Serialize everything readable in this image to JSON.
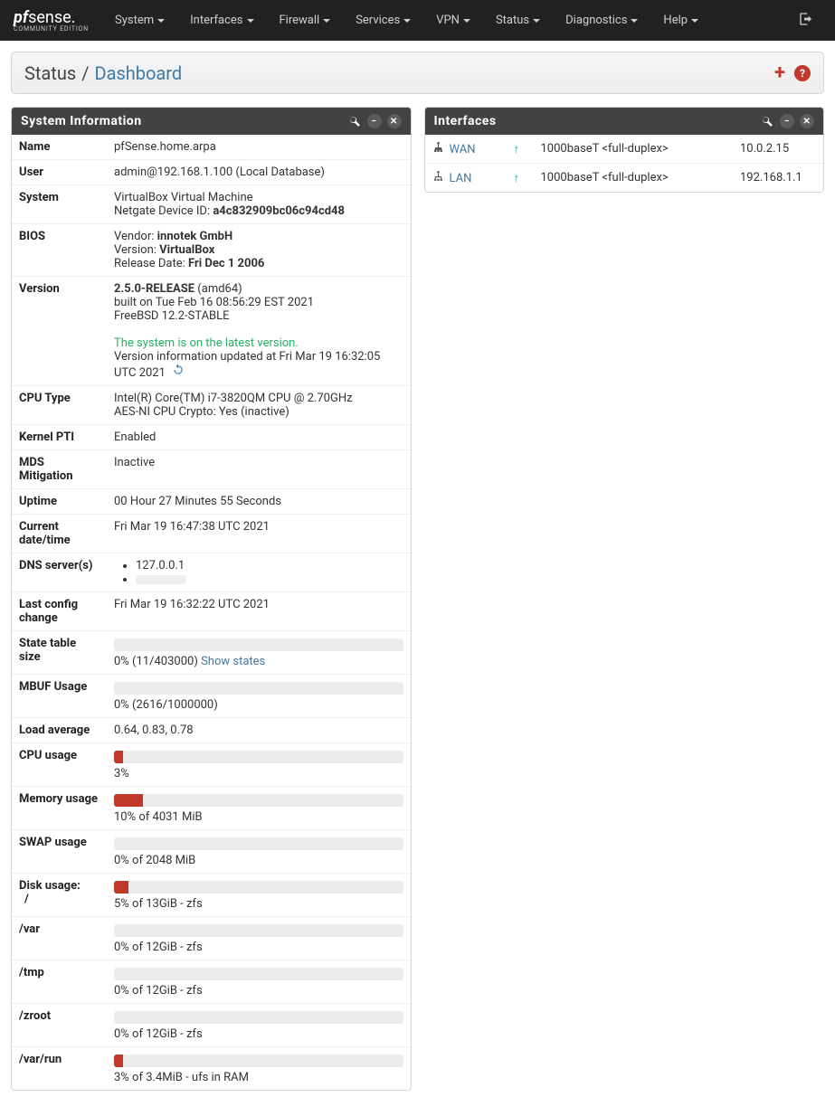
{
  "logo": {
    "pf": "pf",
    "sense": "sense",
    "period": ".",
    "ce": "COMMUNITY EDITION"
  },
  "nav": [
    "System",
    "Interfaces",
    "Firewall",
    "Services",
    "VPN",
    "Status",
    "Diagnostics",
    "Help"
  ],
  "breadcrumb": {
    "root": "Status",
    "page": "Dashboard"
  },
  "panels": {
    "sysinfo": "System Information",
    "ifaces": "Interfaces"
  },
  "sys": {
    "name_k": "Name",
    "name_v": "pfSense.home.arpa",
    "user_k": "User",
    "user_v": "admin@192.168.1.100 (Local Database)",
    "system_k": "System",
    "system_v1": "VirtualBox Virtual Machine",
    "system_v2_lbl": "Netgate Device ID: ",
    "system_v2_val": "a4c832909bc06c94cd48",
    "bios_k": "BIOS",
    "bios_vendor_lbl": "Vendor: ",
    "bios_vendor_val": "innotek GmbH",
    "bios_ver_lbl": "Version: ",
    "bios_ver_val": "VirtualBox",
    "bios_rel_lbl": "Release Date: ",
    "bios_rel_val": "Fri Dec 1 2006",
    "ver_k": "Version",
    "ver_rel": "2.5.0-RELEASE",
    "ver_arch": " (amd64)",
    "ver_built": "built on Tue Feb 16 08:56:29 EST 2021",
    "ver_os": "FreeBSD 12.2-STABLE",
    "ver_latest": "The system is on the latest version.",
    "ver_updated": "Version information updated at Fri Mar 19 16:32:05 UTC 2021",
    "cpu_k": "CPU Type",
    "cpu_v1": "Intel(R) Core(TM) i7-3820QM CPU @ 2.70GHz",
    "cpu_v2": "AES-NI CPU Crypto: Yes (inactive)",
    "pti_k": "Kernel PTI",
    "pti_v": "Enabled",
    "mds_k": "MDS Mitigation",
    "mds_v": "Inactive",
    "up_k": "Uptime",
    "up_v": "00 Hour 27 Minutes 55 Seconds",
    "dt_k": "Current date/time",
    "dt_v": "Fri Mar 19 16:47:38 UTC 2021",
    "dns_k": "DNS server(s)",
    "dns1": "127.0.0.1",
    "lc_k": "Last config change",
    "lc_v": "Fri Mar 19 16:32:22 UTC 2021",
    "st_k": "State table size",
    "st_v": "0% (11/403000) ",
    "st_link": "Show states",
    "mb_k": "MBUF Usage",
    "mb_v": "0% (2616/1000000)",
    "la_k": "Load average",
    "la_v": "0.64, 0.83, 0.78",
    "cu_k": "CPU usage",
    "cu_v": "3%",
    "mu_k": "Memory usage",
    "mu_v": "10% of 4031 MiB",
    "sw_k": "SWAP usage",
    "sw_v": "0% of 2048 MiB",
    "du_k": "Disk usage:",
    "du_root_k": "/",
    "du_root_v": "5% of 13GiB - zfs",
    "du_var_k": "/var",
    "du_var_v": "0% of 12GiB - zfs",
    "du_tmp_k": "/tmp",
    "du_tmp_v": "0% of 12GiB - zfs",
    "du_zroot_k": "/zroot",
    "du_zroot_v": "0% of 12GiB - zfs",
    "du_varrun_k": "/var/run",
    "du_varrun_v": "3% of 3.4MiB - ufs in RAM"
  },
  "bars": {
    "state": 0,
    "mbuf": 0,
    "cpu": 3,
    "mem": 10,
    "swap": 0,
    "root": 5,
    "var": 0,
    "tmp": 0,
    "zroot": 0,
    "varrun": 3
  },
  "ifaces": [
    {
      "name": "WAN",
      "speed": "1000baseT <full-duplex>",
      "ip": "10.0.2.15"
    },
    {
      "name": "LAN",
      "speed": "1000baseT <full-duplex>",
      "ip": "192.168.1.1"
    }
  ]
}
